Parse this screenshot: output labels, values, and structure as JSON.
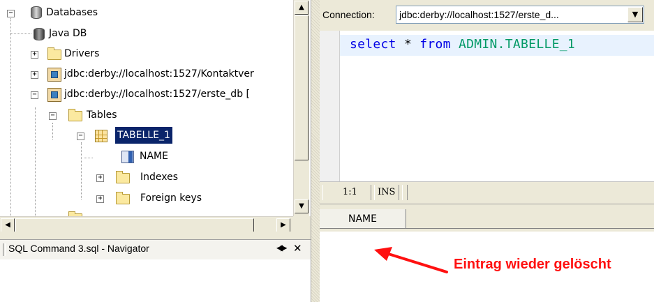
{
  "tree": {
    "items": [
      {
        "label": "Databases",
        "icon": "database-stack-icon"
      },
      {
        "label": "Java DB",
        "icon": "database-icon"
      },
      {
        "label": "Drivers",
        "icon": "folder-icon"
      },
      {
        "label": "jdbc:derby://localhost:1527/Kontaktver",
        "icon": "connection-icon"
      },
      {
        "label": "jdbc:derby://localhost:1527/erste_db [",
        "icon": "connection-icon"
      },
      {
        "label": "Tables",
        "icon": "folder-icon"
      },
      {
        "label": "TABELLE_1",
        "icon": "table-icon"
      },
      {
        "label": "NAME",
        "icon": "column-icon"
      },
      {
        "label": "Indexes",
        "icon": "folder-icon"
      },
      {
        "label": "Foreign keys",
        "icon": "folder-icon"
      }
    ]
  },
  "navigator": {
    "title": "SQL Command 3.sql - Navigator",
    "pin_icon": "◀▶",
    "close_icon": "✕"
  },
  "connection": {
    "label": "Connection:",
    "value": "jdbc:derby://localhost:1527/erste_d...",
    "dropdown_icon": "▼"
  },
  "editor": {
    "keyword1": "select",
    "star": " * ",
    "keyword2": "from",
    "space": " ",
    "identifier": "ADMIN.TABELLE_1"
  },
  "status": {
    "position": "1:1",
    "mode": "INS"
  },
  "results": {
    "columns": [
      "NAME"
    ]
  },
  "annotation": {
    "text": "Eintrag wieder gelöscht",
    "color": "#ff1010"
  },
  "scroll": {
    "up": "▲",
    "down": "▼",
    "left": "◀",
    "right": "▶"
  }
}
